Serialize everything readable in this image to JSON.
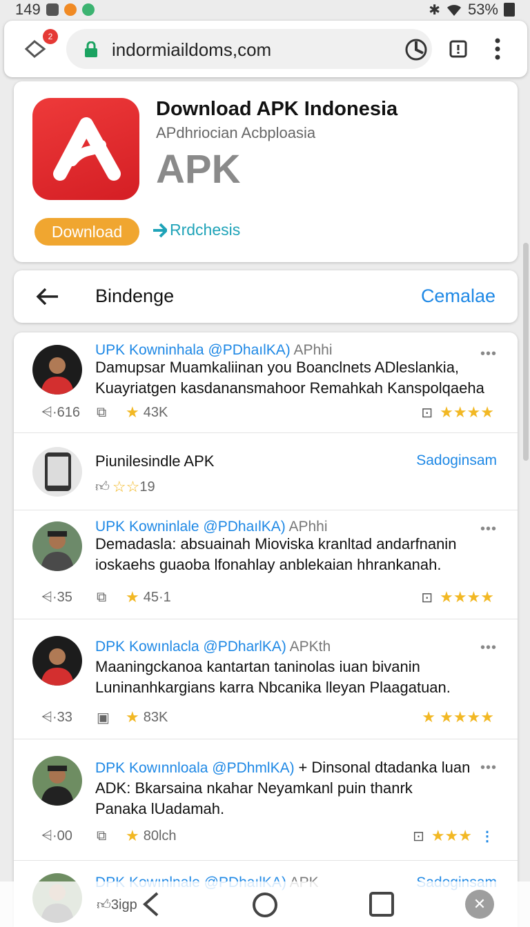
{
  "status": {
    "time": "149",
    "battery": "53%"
  },
  "browser": {
    "tab_badge": "2",
    "url": "indormiaildoms,com"
  },
  "app_card": {
    "title": "Download APK Indonesia",
    "subtitle": "APdhriocian Acbploasia",
    "big_label": "APK",
    "download_label": "Download",
    "secondary_label": "Rrdchesis"
  },
  "section": {
    "title": "Bindenge",
    "action": "Cemalae"
  },
  "feed": {
    "rows": [
      {
        "name": "UPK Kowninhala @PDhaılKA)",
        "tag": "APhhi",
        "body": "Damupsar Muamkaliinan you Boanclnets ADleslankia, Kuayriatgen kasdanansmahoor Remahkah Kanspolqaeha",
        "likes": "616",
        "rating": "43K",
        "stars": 4
      },
      {
        "name": "Piunilesindle APK",
        "link": "Sadoginsam",
        "count": "19"
      },
      {
        "name": "UPK Kowninlale @PDhaılKA)",
        "tag": "APhhi",
        "body": "Demadasla: absuainah Mioviska kranltad andarfnanin ioskaehs guaoba lfonahlay anblekaian hhrankanah.",
        "likes": "35",
        "rating": "45·1",
        "stars": 4
      },
      {
        "name": "DPK Kowınlacla @PDharlKA)",
        "tag": "APKth",
        "body": "Maaningckanoa kantartan taninolas iuan bivanin Luninanhkargians karra Nbcanika lleyan Plaagatuan.",
        "likes": "33",
        "rating": "83K",
        "stars": 5
      },
      {
        "name": "DPK Kowınnloala @PDhmlKA)",
        "tag": "+ Dinsonal dtadanka luan",
        "body": "ADK: Bkarsaina nkahar Neyamkanl puin thanrk Panaka lUadamah.",
        "likes": "00",
        "rating": "80lch",
        "stars": 3
      },
      {
        "name": "DPK Kowınlnale @PDhaılKA)",
        "tag": "APK",
        "link": "Sadoginsam",
        "count": "3igp"
      }
    ]
  },
  "colors": {
    "accent": "#1e88e5",
    "download": "#f0a630",
    "star": "#f2b824",
    "brand_red": "#e33131"
  }
}
